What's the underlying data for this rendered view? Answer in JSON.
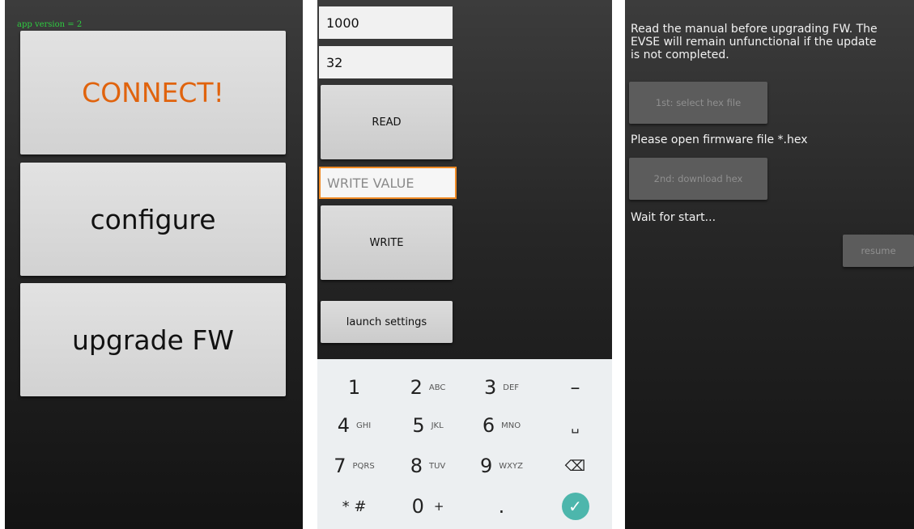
{
  "screen1": {
    "app_version": "app version = 2",
    "connect_label": "CONNECT!",
    "configure_label": "configure",
    "upgrade_label": "upgrade FW",
    "accent_color": "#e0630d"
  },
  "screen2": {
    "field1_value": "1000",
    "field2_value": "32",
    "read_label": "READ",
    "write_value_placeholder": "WRITE VALUE",
    "write_label": "WRITE",
    "launch_settings_label": "launch settings",
    "keypad": [
      {
        "name": "key-1",
        "main": "1",
        "sub": ""
      },
      {
        "name": "key-2",
        "main": "2",
        "sub": "ABC"
      },
      {
        "name": "key-3",
        "main": "3",
        "sub": "DEF"
      },
      {
        "name": "key-minus",
        "main": "–",
        "sub": ""
      },
      {
        "name": "key-4",
        "main": "4",
        "sub": "GHI"
      },
      {
        "name": "key-5",
        "main": "5",
        "sub": "JKL"
      },
      {
        "name": "key-6",
        "main": "6",
        "sub": "MNO"
      },
      {
        "name": "key-space",
        "main": "␣",
        "sub": ""
      },
      {
        "name": "key-7",
        "main": "7",
        "sub": "PQRS"
      },
      {
        "name": "key-8",
        "main": "8",
        "sub": "TUV"
      },
      {
        "name": "key-9",
        "main": "9",
        "sub": "WXYZ"
      },
      {
        "name": "backspace-icon",
        "main": "⌫",
        "sub": ""
      },
      {
        "name": "key-star-hash",
        "main": "* #",
        "sub": ""
      },
      {
        "name": "key-0",
        "main": "0",
        "sub": "+"
      },
      {
        "name": "key-period",
        "main": ".",
        "sub": ""
      },
      {
        "name": "done-check-icon",
        "main": "✓",
        "sub": ""
      }
    ]
  },
  "screen3": {
    "warning_line1": "Read the manual before upgrading FW. The",
    "warning_line2": "EVSE will remain unfunctional if the update",
    "warning_line3": "is not completed.",
    "select_hex_label": "1st: select hex file",
    "open_firmware_text": "Please open firmware file *.hex",
    "download_hex_label": "2nd: download hex",
    "wait_text": "Wait for start...",
    "resume_label": "resume"
  }
}
